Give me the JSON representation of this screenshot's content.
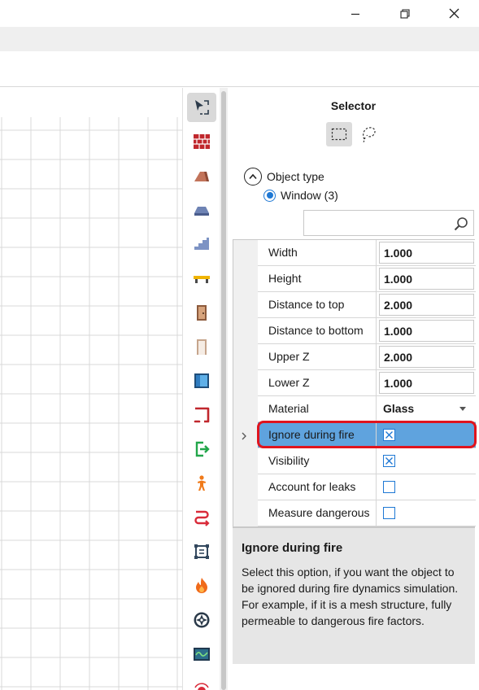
{
  "window_controls": {
    "minimize_icon": "minimize-icon",
    "maximize_icon": "restore-icon",
    "close_icon": "close-icon"
  },
  "toolbar_tools": [
    {
      "name": "select-tool",
      "icon": "cursor-select-icon",
      "active": true
    },
    {
      "name": "wall-tool",
      "icon": "brick-wall-icon"
    },
    {
      "name": "roof-tool",
      "icon": "slope-icon"
    },
    {
      "name": "slab-tool",
      "icon": "slab-icon"
    },
    {
      "name": "stairs-tool",
      "icon": "stairs-icon"
    },
    {
      "name": "bench-tool",
      "icon": "bench-icon"
    },
    {
      "name": "door-tool",
      "icon": "door-icon"
    },
    {
      "name": "doorway-tool",
      "icon": "doorway-icon"
    },
    {
      "name": "window-tool",
      "icon": "window-icon"
    },
    {
      "name": "room-tool",
      "icon": "room-icon"
    },
    {
      "name": "exit-tool",
      "icon": "exit-icon"
    },
    {
      "name": "person-tool",
      "icon": "person-icon"
    },
    {
      "name": "path-tool",
      "icon": "path-icon"
    },
    {
      "name": "area-tool",
      "icon": "area-icon"
    },
    {
      "name": "fire-tool",
      "icon": "fire-icon"
    },
    {
      "name": "fan-tool",
      "icon": "fan-icon"
    },
    {
      "name": "sensor-tool",
      "icon": "sensor-icon"
    },
    {
      "name": "alarm-tool",
      "icon": "alarm-icon"
    }
  ],
  "panel": {
    "title": "Selector",
    "object_type_label": "Object type",
    "object_option": "Window (3)",
    "search_placeholder": ""
  },
  "properties": [
    {
      "name": "Width",
      "value": "1.000",
      "type": "number"
    },
    {
      "name": "Height",
      "value": "1.000",
      "type": "number"
    },
    {
      "name": "Distance to top",
      "value": "2.000",
      "type": "number"
    },
    {
      "name": "Distance to bottom",
      "value": "1.000",
      "type": "number"
    },
    {
      "name": "Upper Z",
      "value": "2.000",
      "type": "number"
    },
    {
      "name": "Lower Z",
      "value": "1.000",
      "type": "number"
    },
    {
      "name": "Material",
      "value": "Glass",
      "type": "select"
    },
    {
      "name": "Ignore during fire",
      "checked": true,
      "type": "checkbox",
      "selected": true
    },
    {
      "name": "Visibility",
      "checked": true,
      "type": "checkbox"
    },
    {
      "name": "Account for leaks",
      "checked": false,
      "type": "checkbox"
    },
    {
      "name": "Measure dangerous",
      "checked": false,
      "type": "checkbox"
    }
  ],
  "description": {
    "title": "Ignore during fire",
    "text_line1": "Select this option, if you want the object to be ignored during fire dynamics simulation.",
    "text_line2": "For example, if it is a mesh structure, fully permeable to dangerous fire factors."
  },
  "colors": {
    "selected_row": "#5fa3de",
    "highlight_border": "#e0141e",
    "checkbox": "#1e78d4",
    "accent_red": "#c0272d"
  }
}
